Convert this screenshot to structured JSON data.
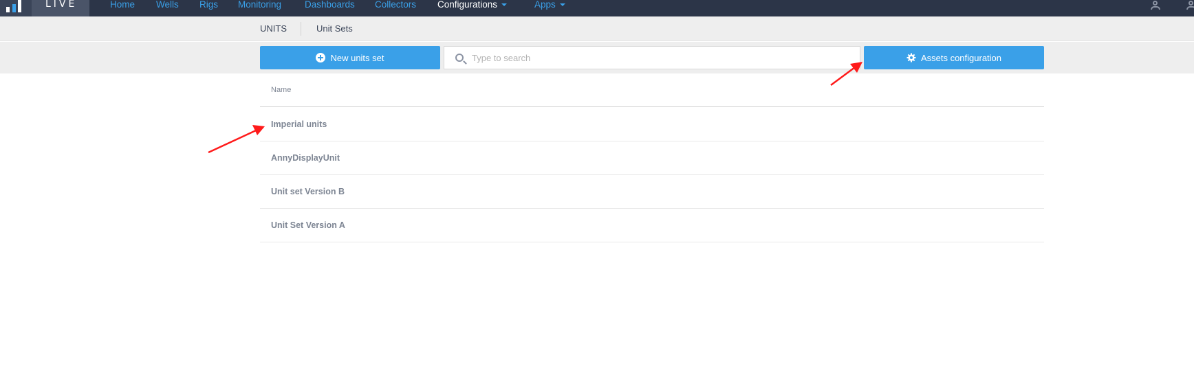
{
  "topnav": {
    "brand": "LIVE",
    "links": [
      {
        "label": "Home"
      },
      {
        "label": "Wells"
      },
      {
        "label": "Rigs"
      },
      {
        "label": "Monitoring"
      },
      {
        "label": "Dashboards"
      },
      {
        "label": "Collectors"
      },
      {
        "label": "Configurations"
      },
      {
        "label": "Apps"
      }
    ],
    "icons": [
      "user-chart-icon",
      "user-icon"
    ]
  },
  "subnav": {
    "section": "UNITS",
    "current": "Unit Sets"
  },
  "toolbar": {
    "new_button": "New units set",
    "search_placeholder": "Type to search",
    "assets_button": "Assets configuration"
  },
  "table": {
    "column_header": "Name",
    "rows": [
      {
        "name": "Imperial units"
      },
      {
        "name": "AnnyDisplayUnit"
      },
      {
        "name": "Unit set Version B"
      },
      {
        "name": "Unit Set Version A"
      }
    ]
  },
  "colors": {
    "nav_bg": "#2c3548",
    "accent": "#3aa0e8",
    "annotation": "#ff1a1a"
  }
}
